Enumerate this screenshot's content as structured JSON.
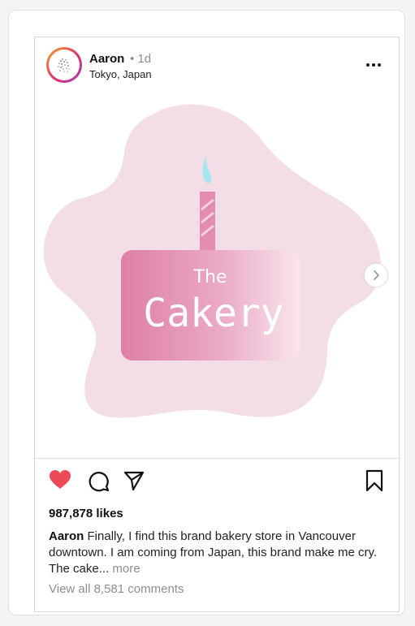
{
  "post": {
    "username": "Aaron",
    "time": "• 1d",
    "location": "Tokyo, Japan",
    "image": {
      "logo_line1": "The",
      "logo_line2": "Cakery"
    },
    "likes": "987,878 likes",
    "caption": {
      "user": "Aaron",
      "text": " Finally, I find this brand bakery store in Vancouver downtown. I am coming from Japan, this brand make me cry. The cake...",
      "more": " more"
    },
    "comments_link": "View all 8,581 comments"
  },
  "icons": {
    "more": "more-horizontal-icon",
    "next": "chevron-right-icon",
    "like": "heart-icon",
    "comment": "comment-icon",
    "share": "send-icon",
    "save": "bookmark-icon"
  },
  "colors": {
    "heart": "#ed4956",
    "blob": "#f3dde6",
    "candle": "#e48bb0",
    "flame": "#9fe3ee",
    "cake_dark": "#df7fa7",
    "cake_light": "#f7e3ec"
  }
}
